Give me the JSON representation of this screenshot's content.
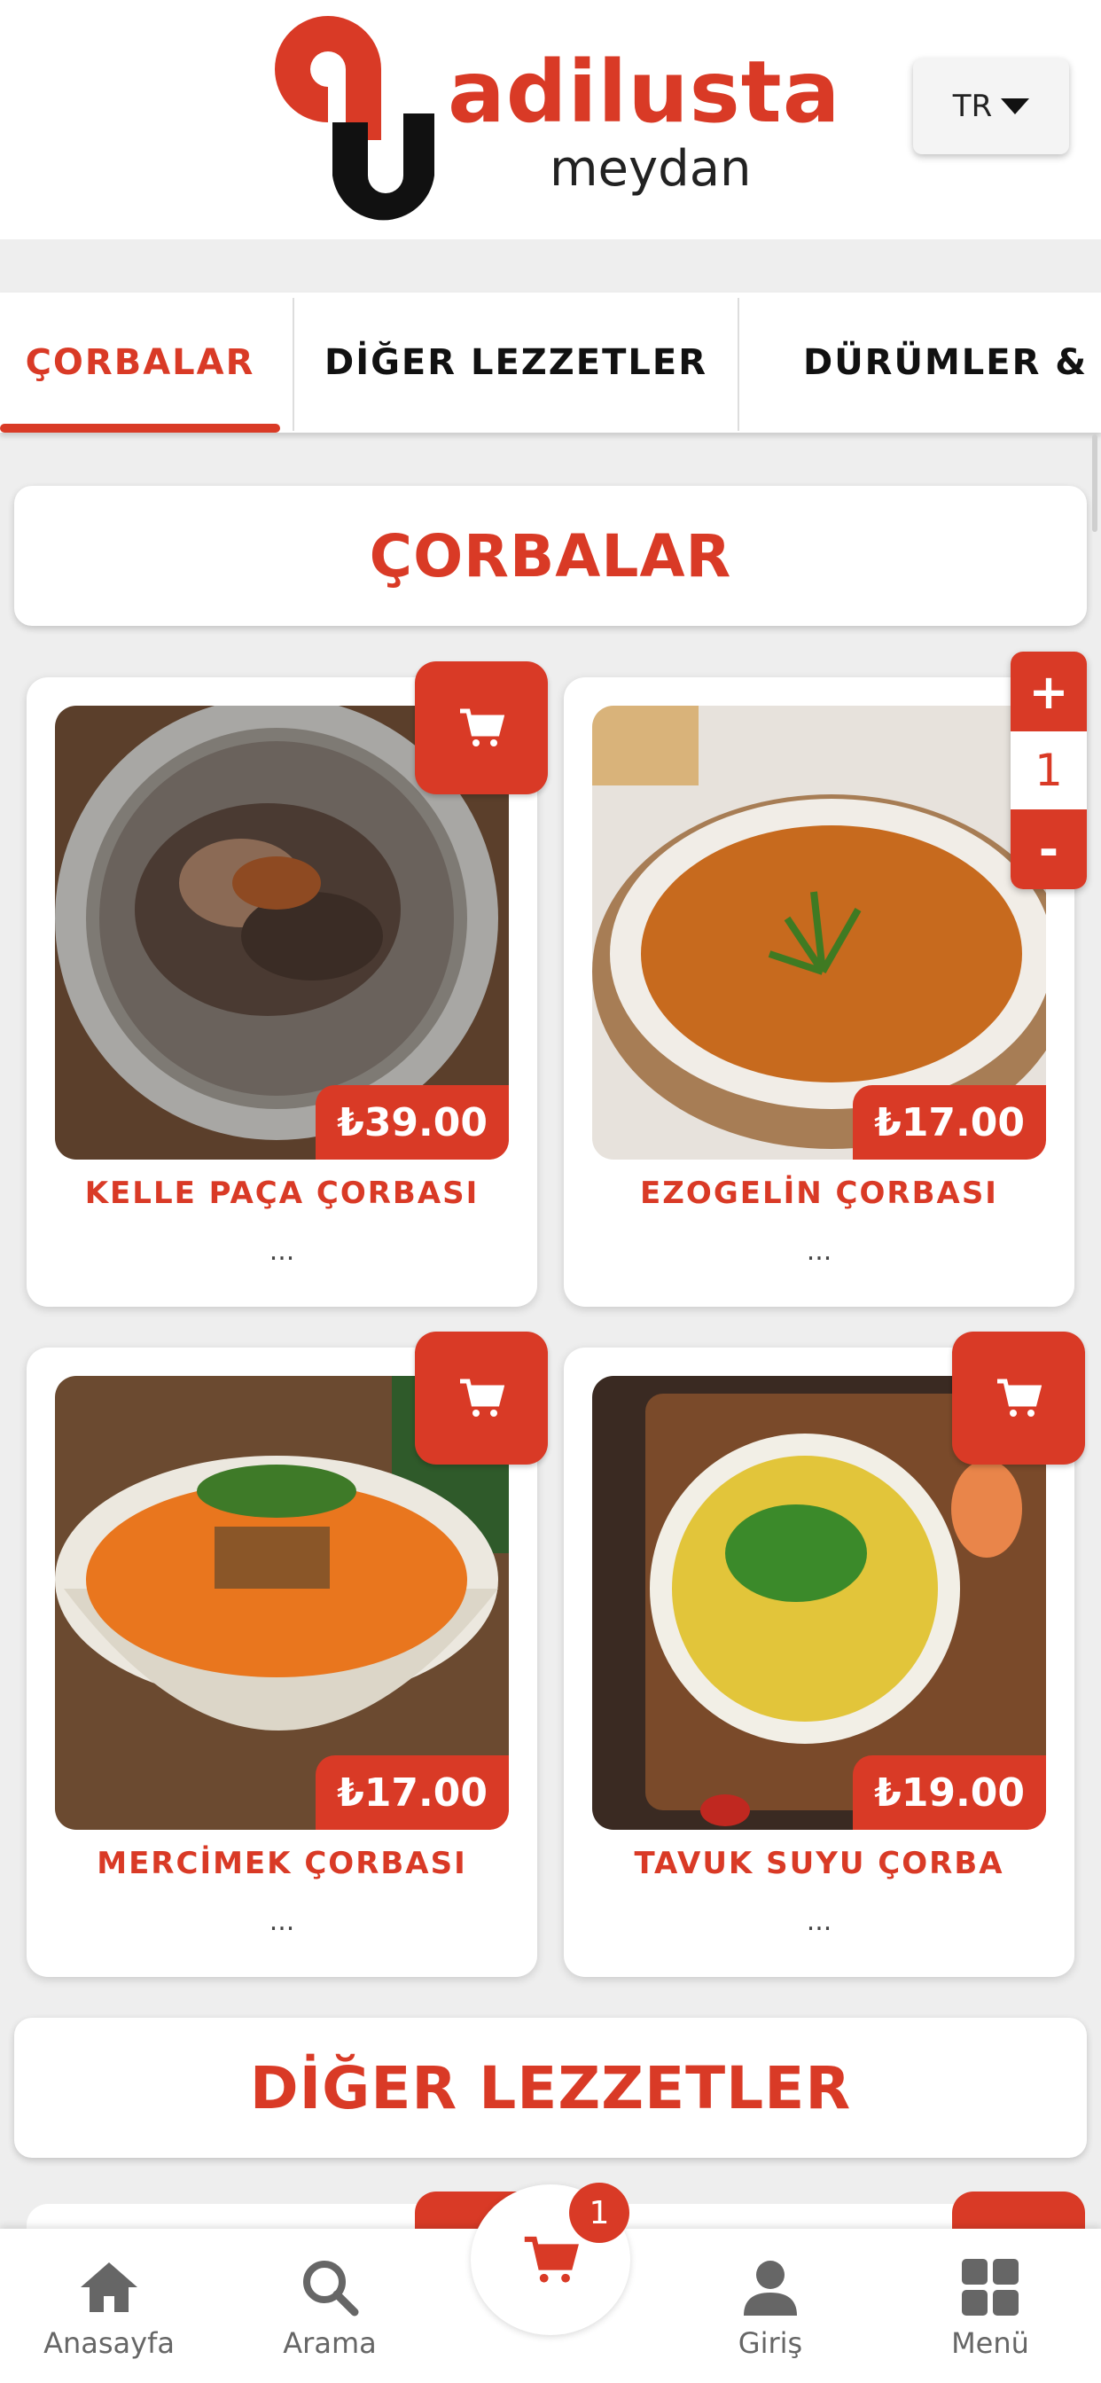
{
  "header": {
    "brand": "adilusta",
    "sub": "meydan",
    "language": "TR"
  },
  "tabs": [
    {
      "label": "ÇORBALAR"
    },
    {
      "label": "DİĞER LEZZETLER"
    },
    {
      "label": "DÜRÜMLER & EK"
    }
  ],
  "sections": [
    {
      "title": "ÇORBALAR"
    },
    {
      "title": "DİĞER LEZZETLER"
    }
  ],
  "products": [
    {
      "name": "KELLE PAÇA ÇORBASI",
      "price": "₺39.00",
      "desc": "..."
    },
    {
      "name": "EZOGELİN ÇORBASI",
      "price": "₺17.00",
      "desc": "..."
    },
    {
      "name": "MERCİMEK ÇORBASI",
      "price": "₺17.00",
      "desc": "..."
    },
    {
      "name": "TAVUK SUYU ÇORBA",
      "price": "₺19.00",
      "desc": "..."
    }
  ],
  "stepper": {
    "plus": "+",
    "qty": "1",
    "minus": "-"
  },
  "cart_badge": "1",
  "bottom_nav": [
    {
      "label": "Anasayfa",
      "icon": "home-icon"
    },
    {
      "label": "Arama",
      "icon": "search-icon"
    },
    {
      "label": "Giriş",
      "icon": "user-icon"
    },
    {
      "label": "Menü",
      "icon": "grid-icon"
    }
  ],
  "colors": {
    "accent": "#d93a26",
    "background": "#eeeeee"
  }
}
